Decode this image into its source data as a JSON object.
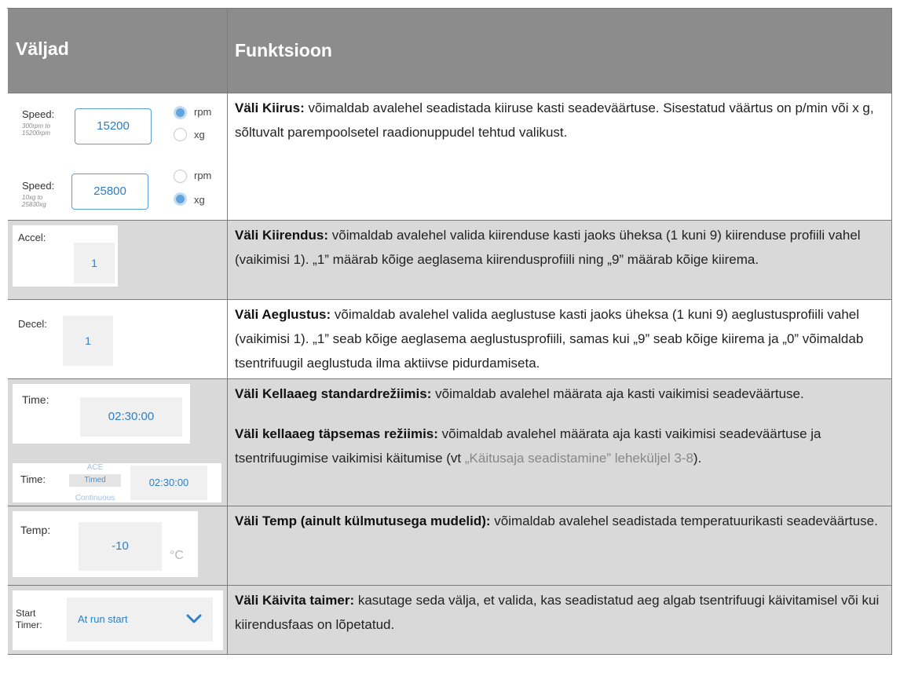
{
  "header": {
    "col1": "Väljad",
    "col2": "Funktsioon"
  },
  "speed": {
    "rpm_widget": {
      "label": "Speed:",
      "range": [
        "300rpm to",
        "15200rpm"
      ],
      "value": "15200",
      "options": [
        "rpm",
        "xg"
      ],
      "selected": "rpm"
    },
    "xg_widget": {
      "label": "Speed:",
      "range": [
        "10xg to",
        "25830xg"
      ],
      "value": "25800",
      "options": [
        "rpm",
        "xg"
      ],
      "selected": "xg"
    },
    "title": "Väli Kiirus:",
    "text": " võimaldab avalehel seadistada kiiruse kasti seadeväärtuse. Sisestatud väärtus on p/min või x g, sõltuvalt parempoolsetel raadionuppudel tehtud valikust."
  },
  "accel": {
    "label": "Accel:",
    "value": "1",
    "title": "Väli Kiirendus:",
    "text": " võimaldab avalehel valida kiirenduse kasti jaoks üheksa (1 kuni 9) kiirenduse profiili vahel (vaikimisi 1). „1” määrab kõige aeglasema kiirendusprofiili ning „9” määrab kõige kiirema."
  },
  "decel": {
    "label": "Decel:",
    "value": "1",
    "title": "Väli Aeglustus:",
    "text": " võimaldab avalehel valida aeglustuse kasti jaoks üheksa (1 kuni 9) aeglustusprofiili vahel (vaikimisi 1). „1” seab kõige aeglasema aeglustusprofiili, samas kui „9” seab kõige kiirema ja „0” võimaldab tsentrifuugil aeglustuda ilma aktiivse pidurdamiseta."
  },
  "time": {
    "standard_widget": {
      "label": "Time:",
      "value": "02:30:00"
    },
    "advanced_widget": {
      "label": "Time:",
      "modes": [
        "ACE",
        "Timed",
        "Continuous"
      ],
      "selected_mode": "Timed",
      "value": "02:30:00"
    },
    "standard_title": "Väli Kellaaeg standardrežiimis:",
    "standard_text": " võimaldab avalehel määrata aja kasti vaikimisi seadeväärtuse.",
    "advanced_title": "Väli kellaaeg täpsemas režiimis:",
    "advanced_text": " võimaldab avalehel määrata aja kasti vaikimisi seadeväärtuse ja tsentrifuugimise vaikimisi käitumise (vt ",
    "advanced_link": "„Käitusaja seadistamine” leheküljel 3-8",
    "advanced_end": ")."
  },
  "temp": {
    "label": "Temp:",
    "value": "-10",
    "unit": "°C",
    "title": "Väli Temp (ainult külmutusega mudelid):",
    "text": " võimaldab avalehel seadistada temperatuurikasti seadeväärtuse."
  },
  "timer": {
    "label_line1": "Start",
    "label_line2": "Timer:",
    "value": "At run start",
    "title": "Väli Käivita taimer:",
    "text": " kasutage seda välja, et valida, kas seadistatud aeg algab tsentrifuugi käivitamisel või kui kiirendusfaas on lõpetatud."
  }
}
